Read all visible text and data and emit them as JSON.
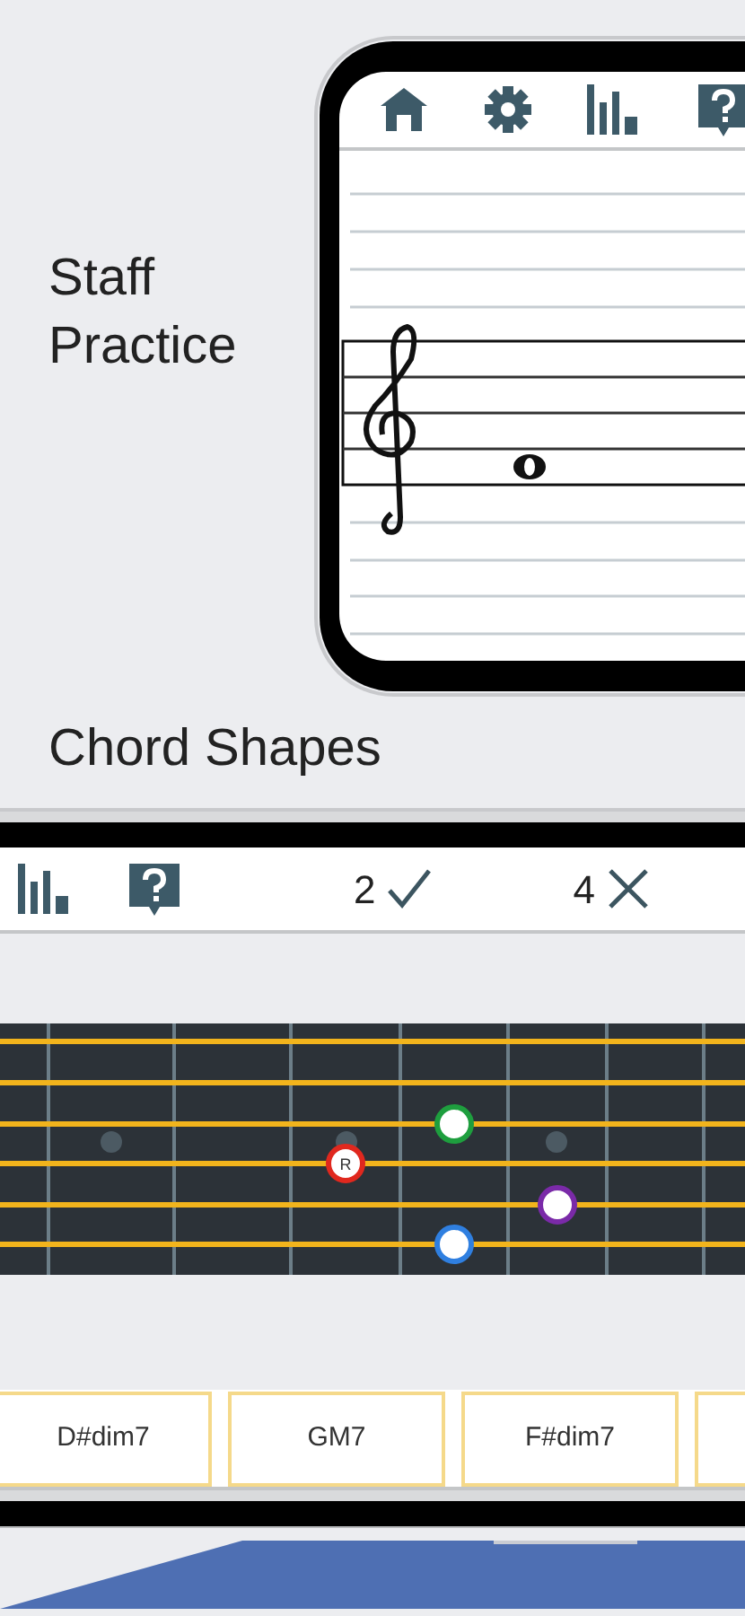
{
  "staff_heading": "Staff Practice",
  "staff_screen": {
    "toolbar": [
      {
        "kind": "home"
      },
      {
        "kind": "settings"
      },
      {
        "kind": "stats"
      },
      {
        "kind": "help"
      }
    ]
  },
  "chord_heading": "Chord Shapes",
  "chord_screen": {
    "toolbar": [
      {
        "kind": "stats"
      },
      {
        "kind": "help"
      }
    ],
    "score": {
      "correct": "2",
      "wrong": "4"
    },
    "fretboard": {
      "notes": [
        {
          "color": "#1e9e3e"
        },
        {
          "color": "#e0281e",
          "label": "R"
        },
        {
          "color": "#7a2aa8"
        },
        {
          "color": "#2f7fe0"
        }
      ]
    },
    "chord_choices": [
      "D#dim7",
      "GM7",
      "F#dim7"
    ]
  }
}
